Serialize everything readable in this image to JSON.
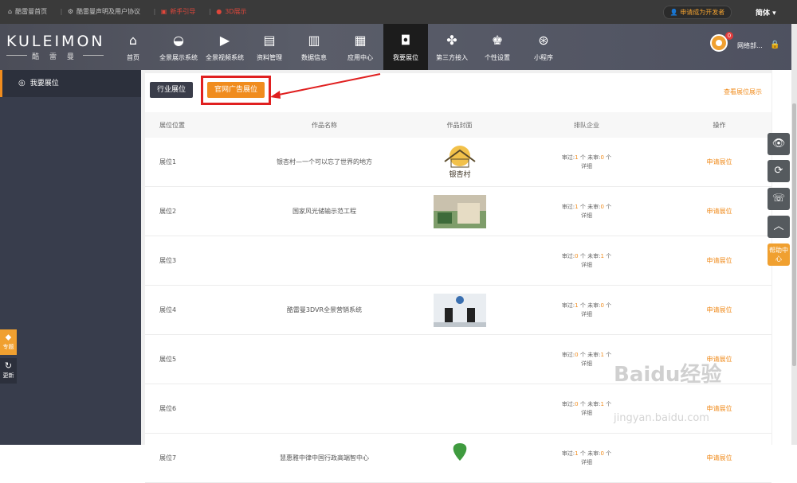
{
  "topbar": {
    "link1": "酷雷曼首页",
    "link2": "酷雷曼声明及用户协议",
    "link3": "新手引导",
    "link4": "3D展示",
    "dev_button": "申请成为开发者",
    "lang": "简体"
  },
  "brand": {
    "logo": "KULEIMON",
    "sub": "酷 雷 曼"
  },
  "nav": [
    {
      "label": "首页",
      "icon": "home-icon"
    },
    {
      "label": "全景展示系统",
      "icon": "panorama-icon"
    },
    {
      "label": "全景视频系统",
      "icon": "video-icon"
    },
    {
      "label": "资料管理",
      "icon": "document-icon"
    },
    {
      "label": "数据信息",
      "icon": "bar-chart-icon"
    },
    {
      "label": "应用中心",
      "icon": "apps-icon"
    },
    {
      "label": "我要展位",
      "icon": "box-icon",
      "active": true
    },
    {
      "label": "第三方接入",
      "icon": "puzzle-icon"
    },
    {
      "label": "个性设置",
      "icon": "user-settings-icon"
    },
    {
      "label": "小程序",
      "icon": "miniapp-icon"
    }
  ],
  "user": {
    "badge": "0",
    "name": "网络部..."
  },
  "sidebar": {
    "item": "我要展位",
    "btn1": "专题",
    "btn2": "更新"
  },
  "tabs": {
    "industry": "行业展位",
    "official": "官网广告展位",
    "view_link": "查看展位展示"
  },
  "table": {
    "headers": [
      "展位位置",
      "作品名称",
      "作品封面",
      "排队企业",
      "操作"
    ],
    "audit_pass_label": "审过:",
    "audit_pending_label": "未审:",
    "unit": "个",
    "detail_label": "详细",
    "apply_label": "申请展位",
    "rows": [
      {
        "pos": "展位1",
        "name": "银杏村—一个可以忘了世界的地方",
        "passed": "1",
        "pending": "0",
        "cover": "logo"
      },
      {
        "pos": "展位2",
        "name": "国家风光储输示范工程",
        "passed": "1",
        "pending": "0",
        "cover": "building"
      },
      {
        "pos": "展位3",
        "name": "",
        "passed": "0",
        "pending": "1",
        "cover": ""
      },
      {
        "pos": "展位4",
        "name": "酷雷曼3DVR全景营销系统",
        "passed": "1",
        "pending": "0",
        "cover": "studio"
      },
      {
        "pos": "展位5",
        "name": "",
        "passed": "0",
        "pending": "1",
        "cover": ""
      },
      {
        "pos": "展位6",
        "name": "",
        "passed": "0",
        "pending": "1",
        "cover": ""
      },
      {
        "pos": "展位7",
        "name": "慧惠雅中律中国行政高端智中心",
        "passed": "1",
        "pending": "0",
        "cover": "plant"
      }
    ]
  },
  "float_help": "帮助中心",
  "watermark": {
    "main": "Baidu经验",
    "sub": "jingyan.baidu.com"
  },
  "colors": {
    "accent": "#f08c1e",
    "highlight": "#e02020",
    "dark": "#3a3d4a"
  }
}
